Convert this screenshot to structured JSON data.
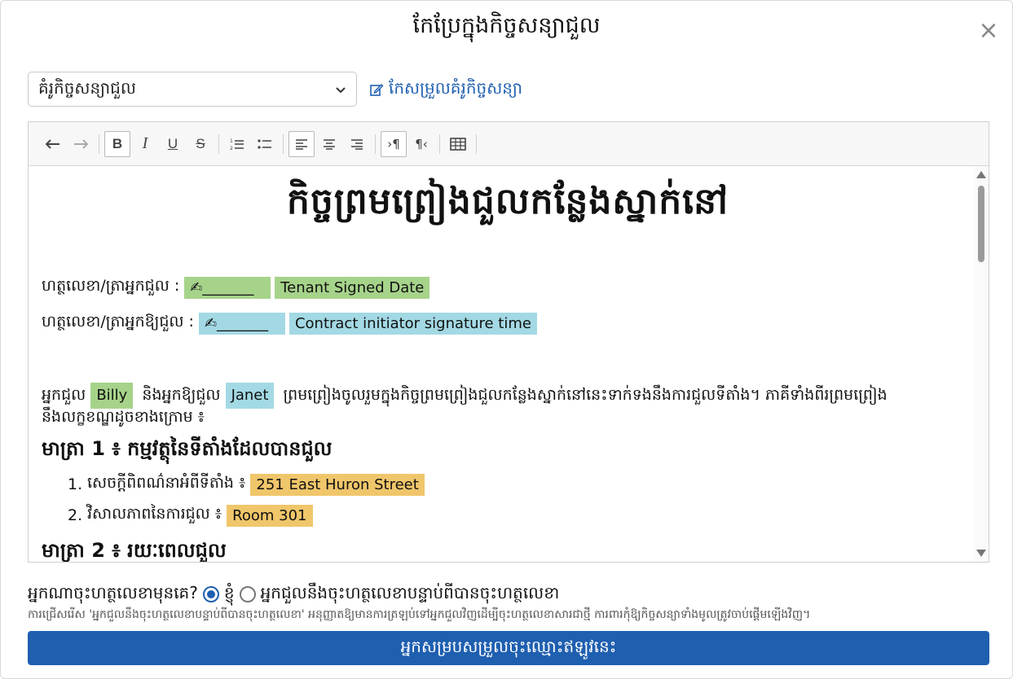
{
  "dialog": {
    "title": "កែប្រែក្នុងកិច្ចសន្យាជួល",
    "close_icon": "close-icon"
  },
  "template": {
    "selected": "គំរូកិច្ចសន្យាជួល",
    "edit_link": "កែសម្រួលគំរូកិច្ចសន្យា"
  },
  "toolbar": {
    "icons": [
      "undo-icon",
      "redo-icon",
      "bold-icon",
      "italic-icon",
      "underline-icon",
      "strikethrough-icon",
      "ordered-list-icon",
      "unordered-list-icon",
      "align-left-icon",
      "align-center-icon",
      "align-right-icon",
      "ltr-icon",
      "rtl-icon",
      "table-icon"
    ]
  },
  "document": {
    "title": "កិច្ចព្រមព្រៀងជួលកន្លែងស្នាក់នៅ",
    "tenant_sig_label": "ហត្ថលេខា/ត្រាអ្នកជួល :",
    "tenant_sig_mark": "✍_______",
    "tenant_sig_date": "Tenant Signed Date",
    "landlord_sig_label": "ហត្ថលេខា/ត្រាអ្នកឱ្យជួល :",
    "landlord_sig_mark": "✍_______",
    "landlord_sig_time": "Contract initiator signature time",
    "para_tenant_prefix": "អ្នកជួល",
    "tenant_name": "Billy",
    "para_landlord_prefix": "និងអ្នកឱ្យជួល",
    "landlord_name": "Janet",
    "para_rest": "ព្រមព្រៀងចូលរួមក្នុងកិច្ចព្រមព្រៀងជួលកន្លែងស្នាក់នៅនេះទាក់ទងនឹងការជួលទីតាំង។ ភាគីទាំងពីរព្រមព្រៀង",
    "para_line2": "នឹងលក្ខខណ្ឌដូចខាងក្រោម ៖",
    "article1_title": "មាត្រា 1 ៖ កម្មវត្ថុនៃទីតាំងដែលបានជួល",
    "item1_num": "1.",
    "item1_label": "សេចក្តីពិពណ៌នាអំពីទីតាំង ៖",
    "item1_value": "251 East Huron Street",
    "item2_num": "2.",
    "item2_label": "វិសាលភាពនៃការជួល ៖",
    "item2_value": "Room 301",
    "article2_title": "មាត្រា 2 ៖ រយៈពេលជួល"
  },
  "signing_order": {
    "question": "អ្នកណាចុះហត្ថលេខាមុនគេ?",
    "option_me": "ខ្ញុំ",
    "option_tenant_after": "អ្នកជួលនឹងចុះហត្ថលេខាបន្ទាប់ពីបានចុះហត្ថលេខា",
    "selected": "me",
    "hint": "ការជ្រើសរើស 'អ្នកជួលនឹងចុះហត្ថលេខាបន្ទាប់ពីបានចុះហត្ថលេខា' អនុញ្ញាតឱ្យមានការត្រឡប់ទៅអ្នកជួលវិញដើម្បីចុះហត្ថលេខាសារជាថ្មី ការពារកុំឱ្យកិច្ចសន្យាទាំងមូលត្រូវចាប់ផ្តើមឡើងវិញ។"
  },
  "submit": {
    "label": "អ្នកសម្របសម្រួលចុះឈ្មោះឥឡូវនេះ"
  }
}
